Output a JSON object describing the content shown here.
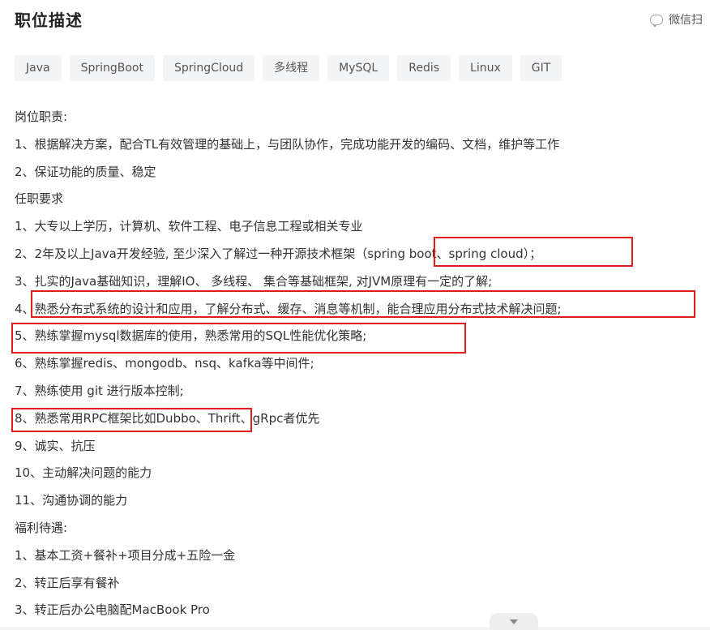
{
  "title": "职位描述",
  "share": {
    "label": "微信扫"
  },
  "tags": [
    "Java",
    "SpringBoot",
    "SpringCloud",
    "多线程",
    "MySQL",
    "Redis",
    "Linux",
    "GIT"
  ],
  "lines": [
    "岗位职责:",
    "1、根据解决方案，配合TL有效管理的基础上，与团队协作，完成功能开发的编码、文档，维护等工作",
    "2、保证功能的质量、稳定",
    "任职要求",
    "1、大专以上学历，计算机、软件工程、电子信息工程或相关专业",
    "2、2年及以上Java开发经验, 至少深入了解过一种开源技术框架（spring boot、spring cloud）；",
    "3、扎实的Java基础知识，理解IO、 多线程、 集合等基础框架, 对JVM原理有一定的了解;",
    "4、熟悉分布式系统的设计和应用，了解分布式、缓存、消息等机制，能合理应用分布式技术解决问题;",
    "5、熟练掌握mysql数据库的使用，熟悉常用的SQL性能优化策略;",
    "6、熟练掌握redis、mongodb、nsq、kafka等中间件;",
    "7、熟练使用 git 进行版本控制;",
    "8、熟悉常用RPC框架比如Dubbo、Thrift、gRpc者优先",
    "9、诚实、抗压",
    "10、主动解决问题的能力",
    "11、沟通协调的能力",
    "福利待遇:",
    "1、基本工资+餐补+项目分成+五险一金",
    "2、转正后享有餐补",
    "3、转正后办公电脑配MacBook Pro"
  ],
  "colors": {
    "highlight": "#e31b1b",
    "tag_bg": "#f3f4f6"
  }
}
